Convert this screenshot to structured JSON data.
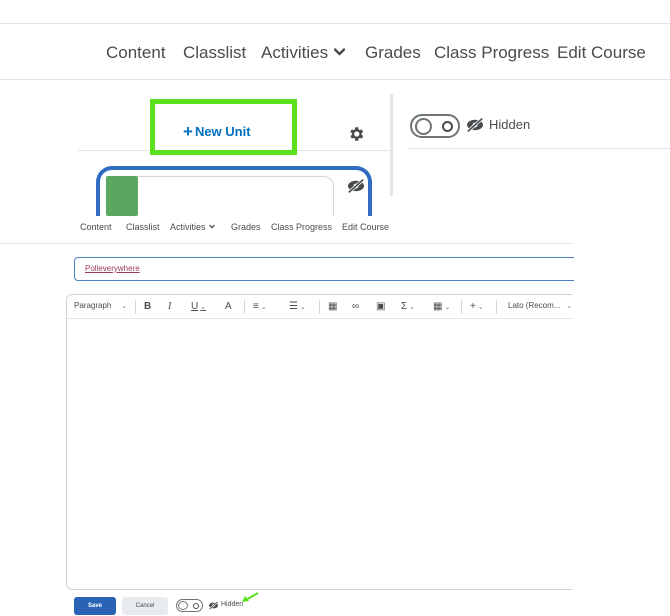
{
  "top_nav": {
    "items": [
      "Content",
      "Classlist",
      "Activities",
      "Grades",
      "Class Progress",
      "Edit Course"
    ]
  },
  "unit_panel": {
    "new_unit_label": "New Unit",
    "new_unit_icon": "plus-icon",
    "settings_icon": "gear-icon",
    "visibility_label": "Hidden",
    "visibility_icon": "eye-slash-icon",
    "highlight_color": "#5ce01c"
  },
  "bottom_nav": {
    "items": [
      "Content",
      "Classlist",
      "Activities",
      "Grades",
      "Class Progress",
      "Edit Course"
    ]
  },
  "editor": {
    "title_value": "Polleverywhere",
    "toolbar": {
      "format": "Paragraph",
      "font": "Lato (Recom..."
    }
  },
  "actions": {
    "save_label": "Save",
    "cancel_label": "Cancel",
    "visibility_label": "Hidden",
    "accent_color": "#2a63b5"
  }
}
